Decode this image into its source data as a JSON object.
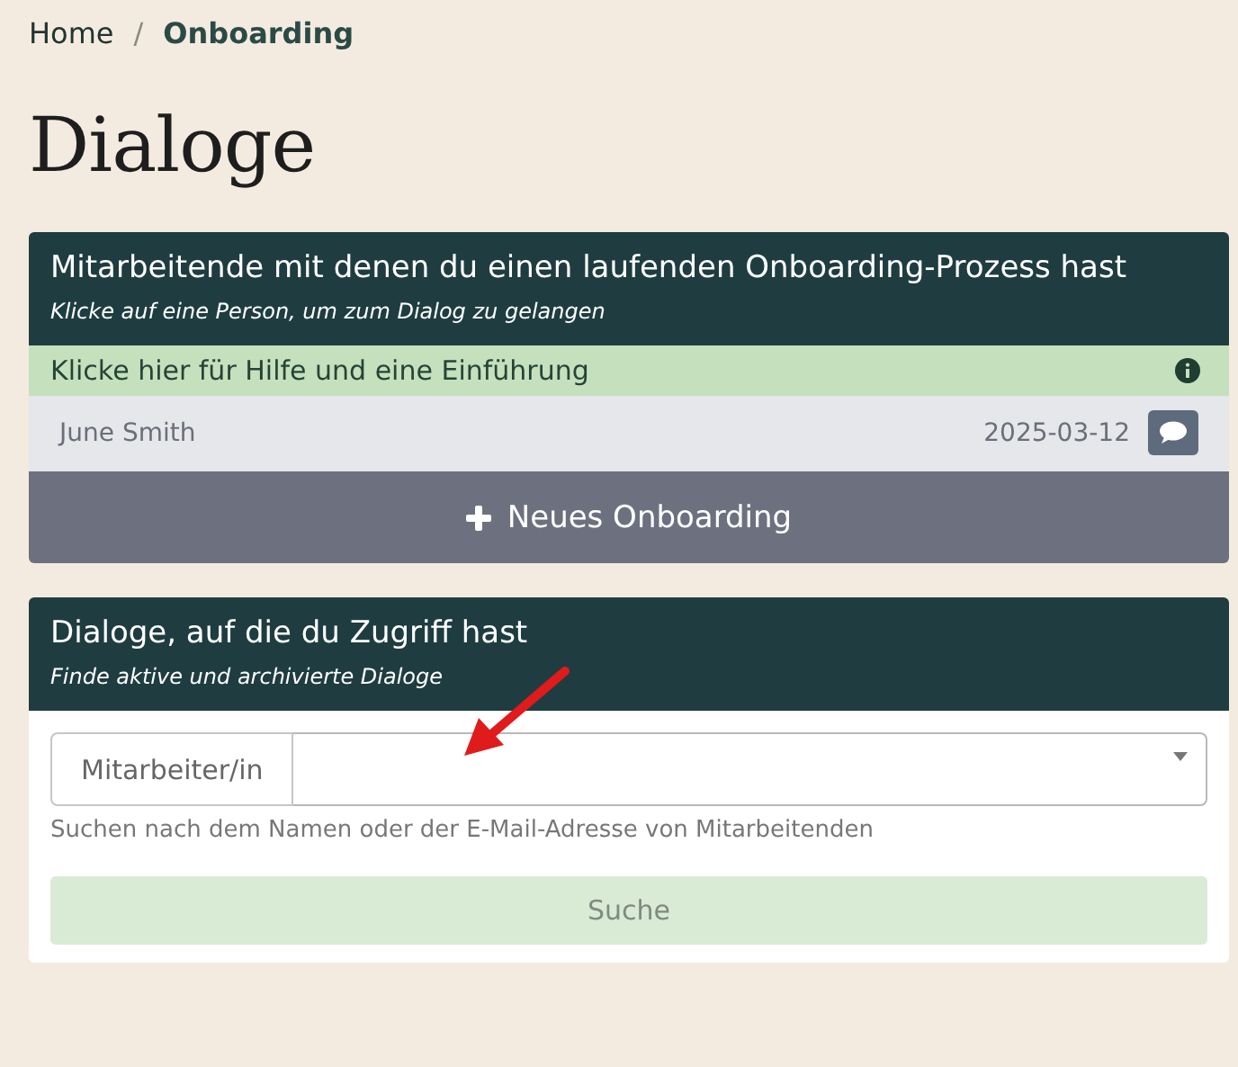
{
  "breadcrumb": [
    {
      "label": "Home",
      "selected": false
    },
    {
      "label": "Onboarding",
      "selected": true
    }
  ],
  "breadcrumb_separator": "/",
  "page_title": "Dialoge",
  "onboarding_card": {
    "title": "Mitarbeitende mit denen du einen laufenden Onboarding-Prozess hast",
    "subtitle": "Klicke auf eine Person, um zum Dialog zu gelangen",
    "help_row": "Klicke hier für Hilfe und eine Einführung",
    "people": [
      {
        "name": "June Smith",
        "date": "2025-03-12"
      }
    ],
    "new_button": "Neues Onboarding"
  },
  "dialog_card": {
    "title": "Dialoge, auf die du Zugriff hast",
    "subtitle": "Finde aktive und archivierte Dialoge",
    "field_label": "Mitarbeiter/in",
    "hint": "Suchen nach dem Namen oder der E-Mail-Adresse von Mitarbeitenden",
    "search_button": {
      "label": "Suche",
      "disabled": true
    }
  }
}
